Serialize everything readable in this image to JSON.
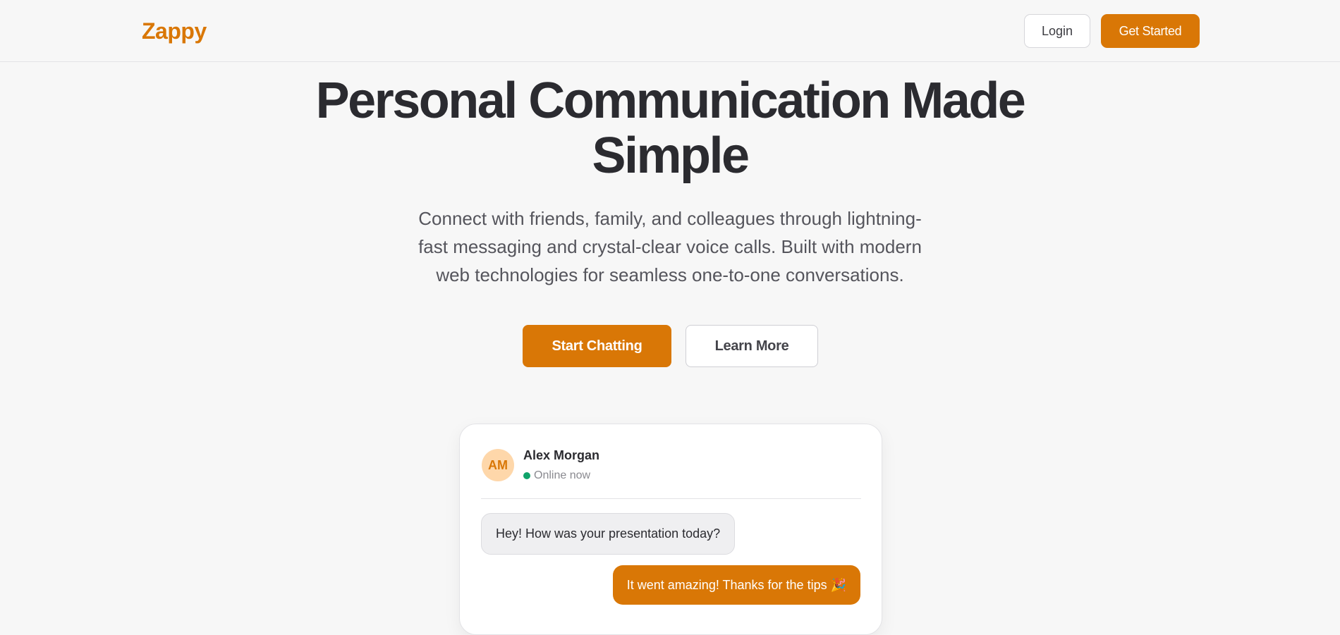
{
  "header": {
    "logo": "Zappy",
    "login_label": "Login",
    "get_started_label": "Get Started"
  },
  "hero": {
    "title_line1": "Personal Communication Made",
    "title_line2": "Simple",
    "subtitle_line1": "Connect with friends, family, and colleagues through lightning-",
    "subtitle_line2": "fast messaging and crystal-clear voice calls. Built with modern",
    "subtitle_line3": "web technologies for seamless one-to-one conversations.",
    "primary_cta": "Start Chatting",
    "secondary_cta": "Learn More"
  },
  "chat_preview": {
    "avatar_initials": "AM",
    "contact_name": "Alex Morgan",
    "status": "Online now",
    "messages": [
      {
        "direction": "incoming",
        "text": "Hey! How was your presentation today?"
      },
      {
        "direction": "outgoing",
        "text": "It went amazing! Thanks for the tips 🎉"
      }
    ]
  },
  "colors": {
    "brand": "#d97706",
    "online": "#10a36a",
    "avatar_bg": "#fed7aa"
  }
}
